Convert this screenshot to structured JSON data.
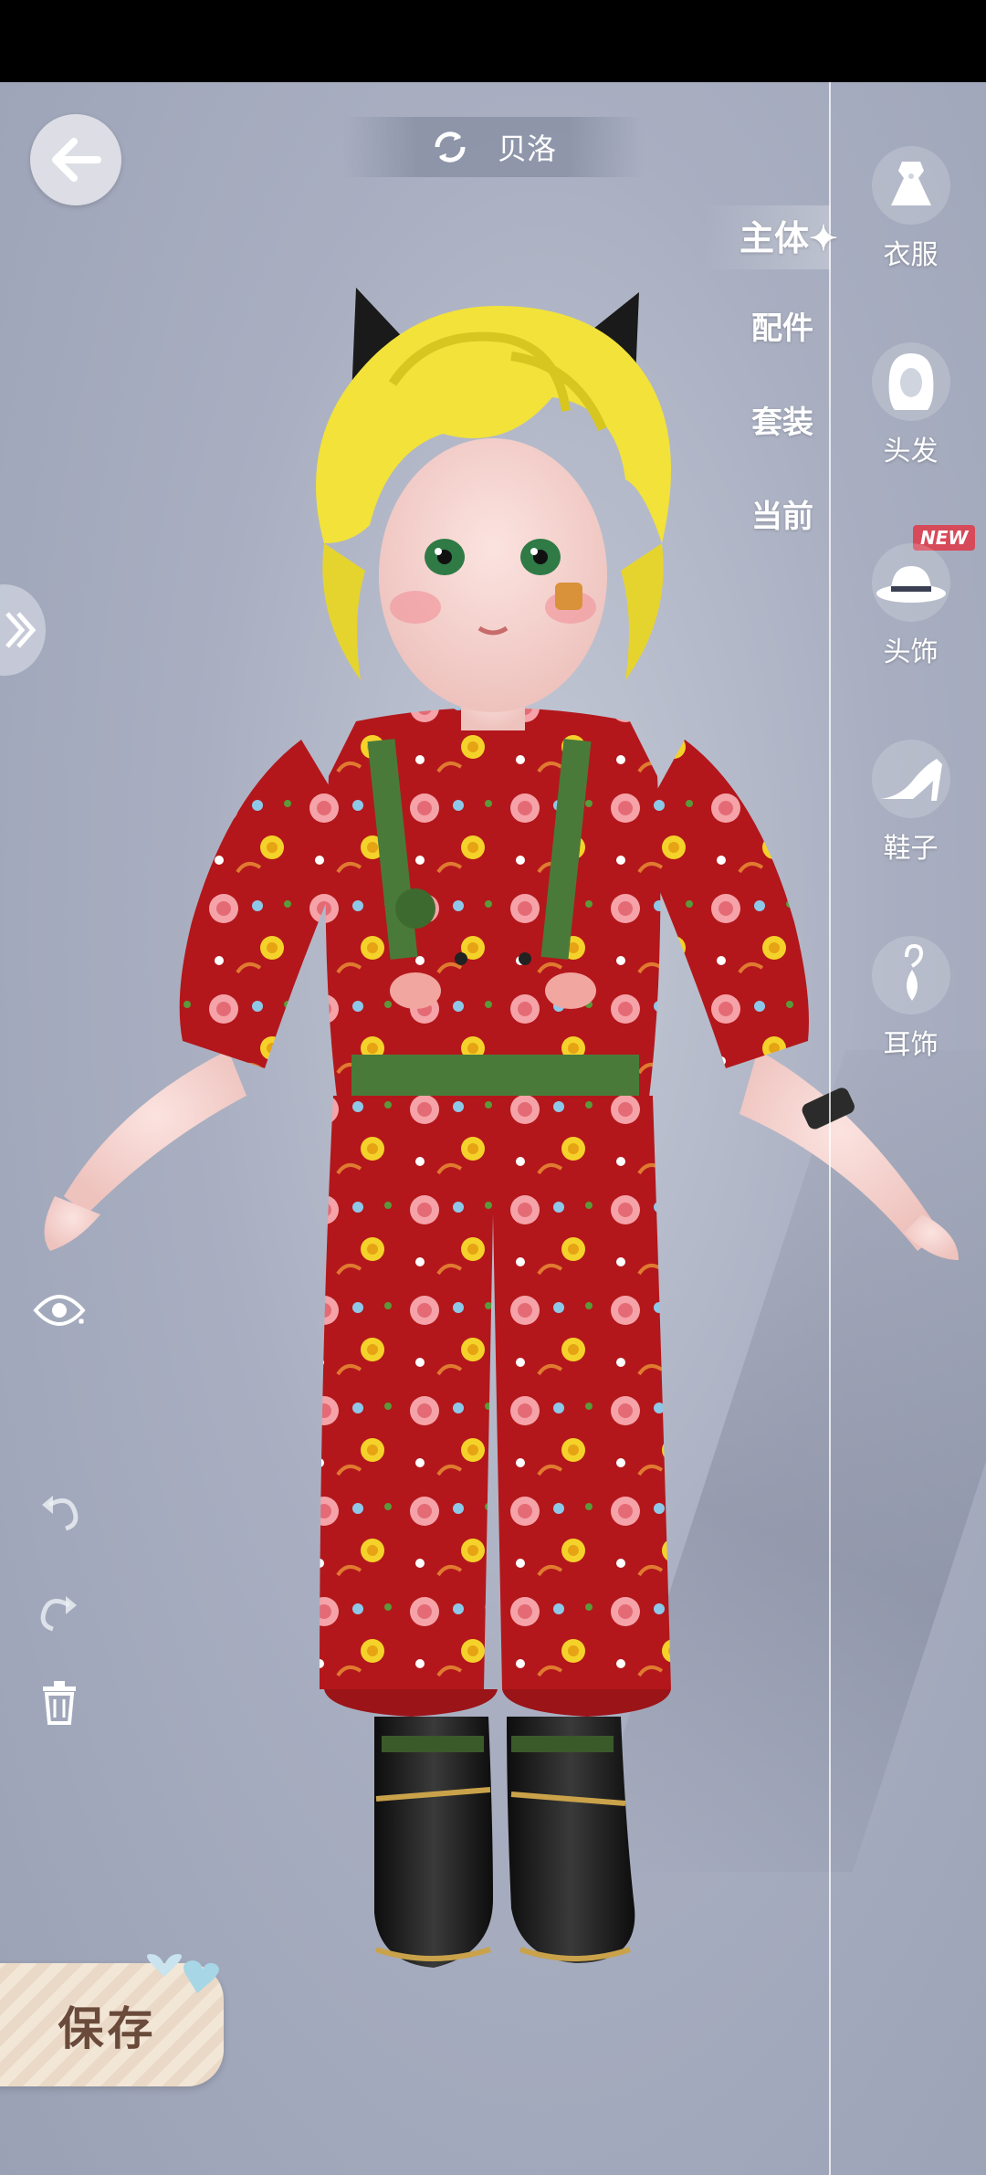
{
  "header": {
    "character_name": "贝洛"
  },
  "tabs": [
    {
      "label": "主体✦",
      "active": true
    },
    {
      "label": "配件",
      "active": false
    },
    {
      "label": "套装",
      "active": false
    },
    {
      "label": "当前",
      "active": false
    }
  ],
  "categories": [
    {
      "label": "衣服",
      "icon": "dress-icon"
    },
    {
      "label": "头发",
      "icon": "hair-icon"
    },
    {
      "label": "头饰",
      "icon": "hat-icon",
      "badge": "NEW"
    },
    {
      "label": "鞋子",
      "icon": "high-heel-icon"
    },
    {
      "label": "耳饰",
      "icon": "earring-icon"
    }
  ],
  "tools": {
    "save_label": "保存"
  },
  "colors": {
    "outfit_red": "#b01c1c",
    "strap_green": "#4a7a3a",
    "hair_yellow": "#f2e23a",
    "new_badge": "#d74a5a"
  }
}
